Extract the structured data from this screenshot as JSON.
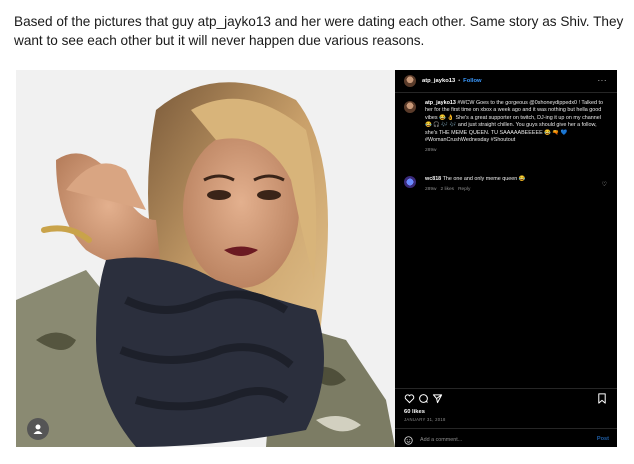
{
  "caption": "Based of the pictures that guy atp_jayko13 and her were dating each other. Same story as Shiv. They want to see each other but it will never happen due various reasons.",
  "instagram": {
    "username": "atp_jayko13",
    "separator": "•",
    "follow_label": "Follow",
    "more_label": "···",
    "post": {
      "author": "atp_jayko13",
      "text": "#WCW Goes to the gorgeous @0shoneydippedx0 ! Talked to her for the first time on xbox a week ago and it was nothing but hella good vibes 😂 👌 She's a great supporter on twitch, DJ-ing it up on my channel 😂 🎧 🎶 🎶 and just straight chillen. You guys should give her a follow, she's THE MEME QUEEN. TU SAAAAABEEEEE 😂 🔫 💙 #WomanCrushWednesday #Shoutout",
      "age": "289w"
    },
    "comment": {
      "author": "wc818",
      "text": "The one and only meme queen 😂",
      "age": "289w",
      "likes": "2 likes",
      "reply": "Reply"
    },
    "likes_count": "60 likes",
    "date": "JANUARY 31, 2018",
    "add_comment_placeholder": "Add a comment...",
    "post_button": "Post"
  },
  "icons": [
    "heart-icon",
    "comment-icon",
    "share-icon",
    "bookmark-icon",
    "emoji-icon",
    "profile-icon"
  ]
}
